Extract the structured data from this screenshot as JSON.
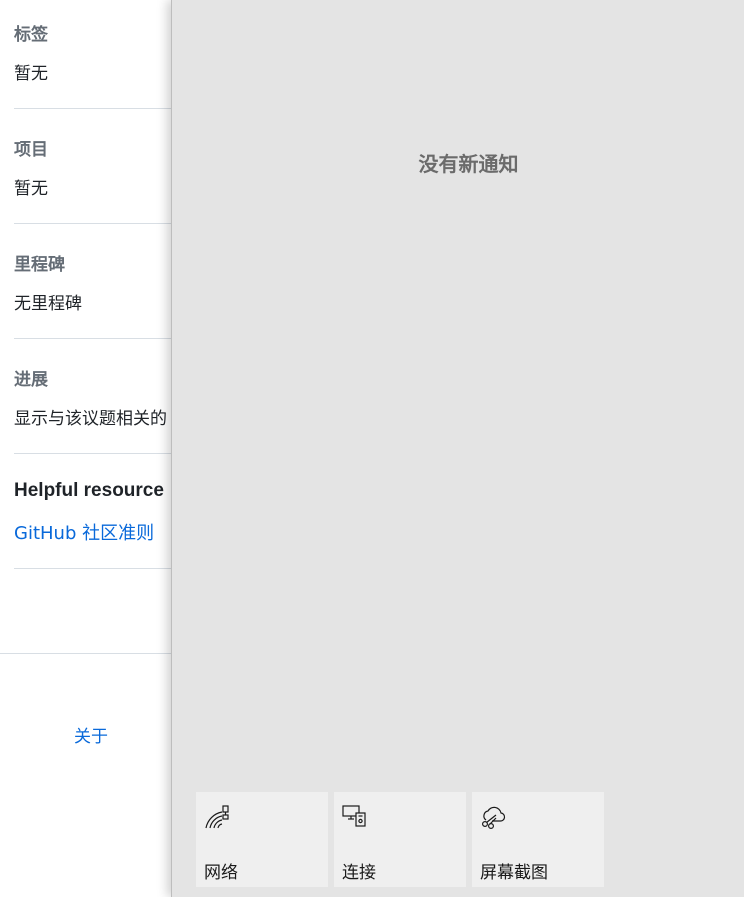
{
  "sidebar": {
    "labels": {
      "heading": "标签",
      "value": "暂无"
    },
    "projects": {
      "heading": "项目",
      "value": "暂无"
    },
    "milestone": {
      "heading": "里程碑",
      "value": "无里程碑"
    },
    "development": {
      "heading": "进展",
      "value": "显示与该议题相关的"
    },
    "resources": {
      "heading": "Helpful resource",
      "link": "GitHub 社区准则"
    },
    "about": "关于"
  },
  "action_center": {
    "empty_message": "没有新通知",
    "quick_actions": [
      {
        "label": "网络",
        "icon": "network-icon"
      },
      {
        "label": "连接",
        "icon": "connect-icon"
      },
      {
        "label": "屏幕截图",
        "icon": "screen-snip-icon"
      }
    ]
  },
  "colors": {
    "link": "#0969da",
    "panel_background": "#e4e4e4",
    "tile_background": "#efefef"
  }
}
